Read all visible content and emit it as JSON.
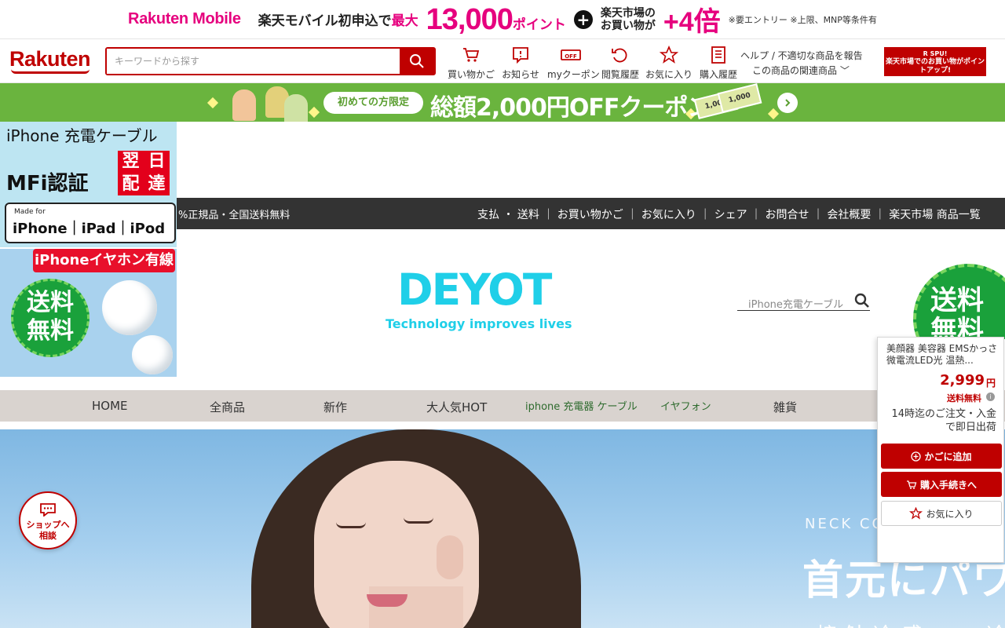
{
  "promo": {
    "brand": "Rakuten Mobile",
    "text1": "楽天モバイル初申込で",
    "max_label": "最大",
    "points": "13,000",
    "points_suffix": "ポイント",
    "plus": "+",
    "text2_line1": "楽天市場の",
    "text2_line2": "お買い物が",
    "multiplier": "+4倍",
    "note": "※要エントリー ※上限、MNP等条件有"
  },
  "header": {
    "logo": "Rakuten",
    "search_placeholder": "キーワードから探す",
    "icons": [
      {
        "label": "買い物かご",
        "icon": "cart-icon"
      },
      {
        "label": "お知らせ",
        "icon": "notification-icon"
      },
      {
        "label": "myクーポン",
        "icon": "coupon-icon"
      },
      {
        "label": "閲覧履歴",
        "icon": "history-icon"
      },
      {
        "label": "お気に入り",
        "icon": "star-icon"
      },
      {
        "label": "購入履歴",
        "icon": "receipt-icon"
      }
    ],
    "help_link": "ヘルプ / 不適切な商品を報告",
    "related_link": "この商品の関連商品",
    "spu_title": "R SPU!",
    "spu_text": "楽天市場でのお買い物がポイントアップ!"
  },
  "coupon_bar": {
    "pill": "初めての方限定",
    "headline": "総額2,000円OFFクーポン",
    "bill1": "1,000",
    "bill2": "1,000"
  },
  "left_ad": {
    "title": "iPhone 充電ケーブル",
    "mfi": "MFi認証",
    "red_chars": [
      "翌",
      "日",
      "配",
      "達"
    ],
    "made_for": "Made for",
    "devices": "iPhone｜iPad｜iPod",
    "ad2_title": "iPhoneイヤホン有線",
    "ad2_badge_line1": "送料",
    "ad2_badge_line2": "無料"
  },
  "shop_bar": {
    "tag": "%正規品・全国送料無料",
    "links": "支払 ・ 送料 ｜ お買い物かご ｜ お気に入り ｜ シェア ｜ お問合せ ｜ 会社概要 ｜ 楽天市場 商品一覧"
  },
  "brand": {
    "name": "DEYOT",
    "slogan": "Technology improves lives",
    "search_placeholder": "iPhone充電ケーブル"
  },
  "right_ad": {
    "line1": "送料",
    "line2": "無料"
  },
  "categories": [
    "HOME",
    "全商品",
    "新作",
    "大人気HOT",
    "iphone 充電器 ケーブル",
    "イヤフォン",
    "雑貨"
  ],
  "hero": {
    "neck_text": "NECK CO",
    "jp_text": "首元にパワ",
    "sub_text": "接触冷感 ・ 冷た"
  },
  "chat": {
    "line1": "ショップへ",
    "line2": "相談"
  },
  "panel": {
    "product_name": "美顔器 美容器 EMSかっさ 微電流LED光 温熱...",
    "price": "2,999",
    "yen": "円",
    "shipping": "送料無料",
    "info": "i",
    "note": "14時迄のご注文・入金で即日出荷",
    "add_cart": "かごに追加",
    "checkout": "購入手続きへ",
    "favorite": "お気に入り"
  },
  "colors": {
    "rakuten_red": "#bf0000",
    "rakuten_mobile_pink": "#e6007e",
    "coupon_green": "#6ab43e",
    "brand_cyan": "#1fcfe8",
    "shop_bar": "#333333",
    "category_bar": "#d9d3cf"
  }
}
